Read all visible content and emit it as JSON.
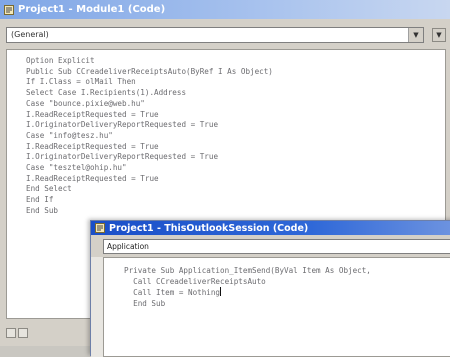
{
  "window1": {
    "title": "Project1 - Module1 (Code)",
    "object_combo": "(General)",
    "code_lines": [
      "Option Explicit",
      "Public Sub CCreadeliverReceiptsAuto(ByRef I As Object)",
      "If I.Class = olMail Then",
      "Select Case I.Recipients(1).Address",
      "Case \"bounce.pixie@web.hu\"",
      "I.ReadReceiptRequested = True",
      "I.OriginatorDeliveryReportRequested = True",
      "Case \"info@tesz.hu\"",
      "I.ReadReceiptRequested = True",
      "I.OriginatorDeliveryReportRequested = True",
      "Case \"tesztel@ohip.hu\"",
      "I.ReadReceiptRequested = True",
      "End Select",
      "End If",
      "End Sub"
    ]
  },
  "window2": {
    "title": "Project1 - ThisOutlookSession (Code)",
    "object_combo": "Application",
    "code_lines": [
      "Private Sub Application_ItemSend(ByVal Item As Object,",
      "Call CCreadeliverReceiptsAuto",
      "Call Item = Nothing",
      "End Sub"
    ]
  },
  "colors": {
    "title_active": "#2f68d8",
    "title_inactive": "#a9c3ee",
    "code_text": "#6c6c70"
  }
}
